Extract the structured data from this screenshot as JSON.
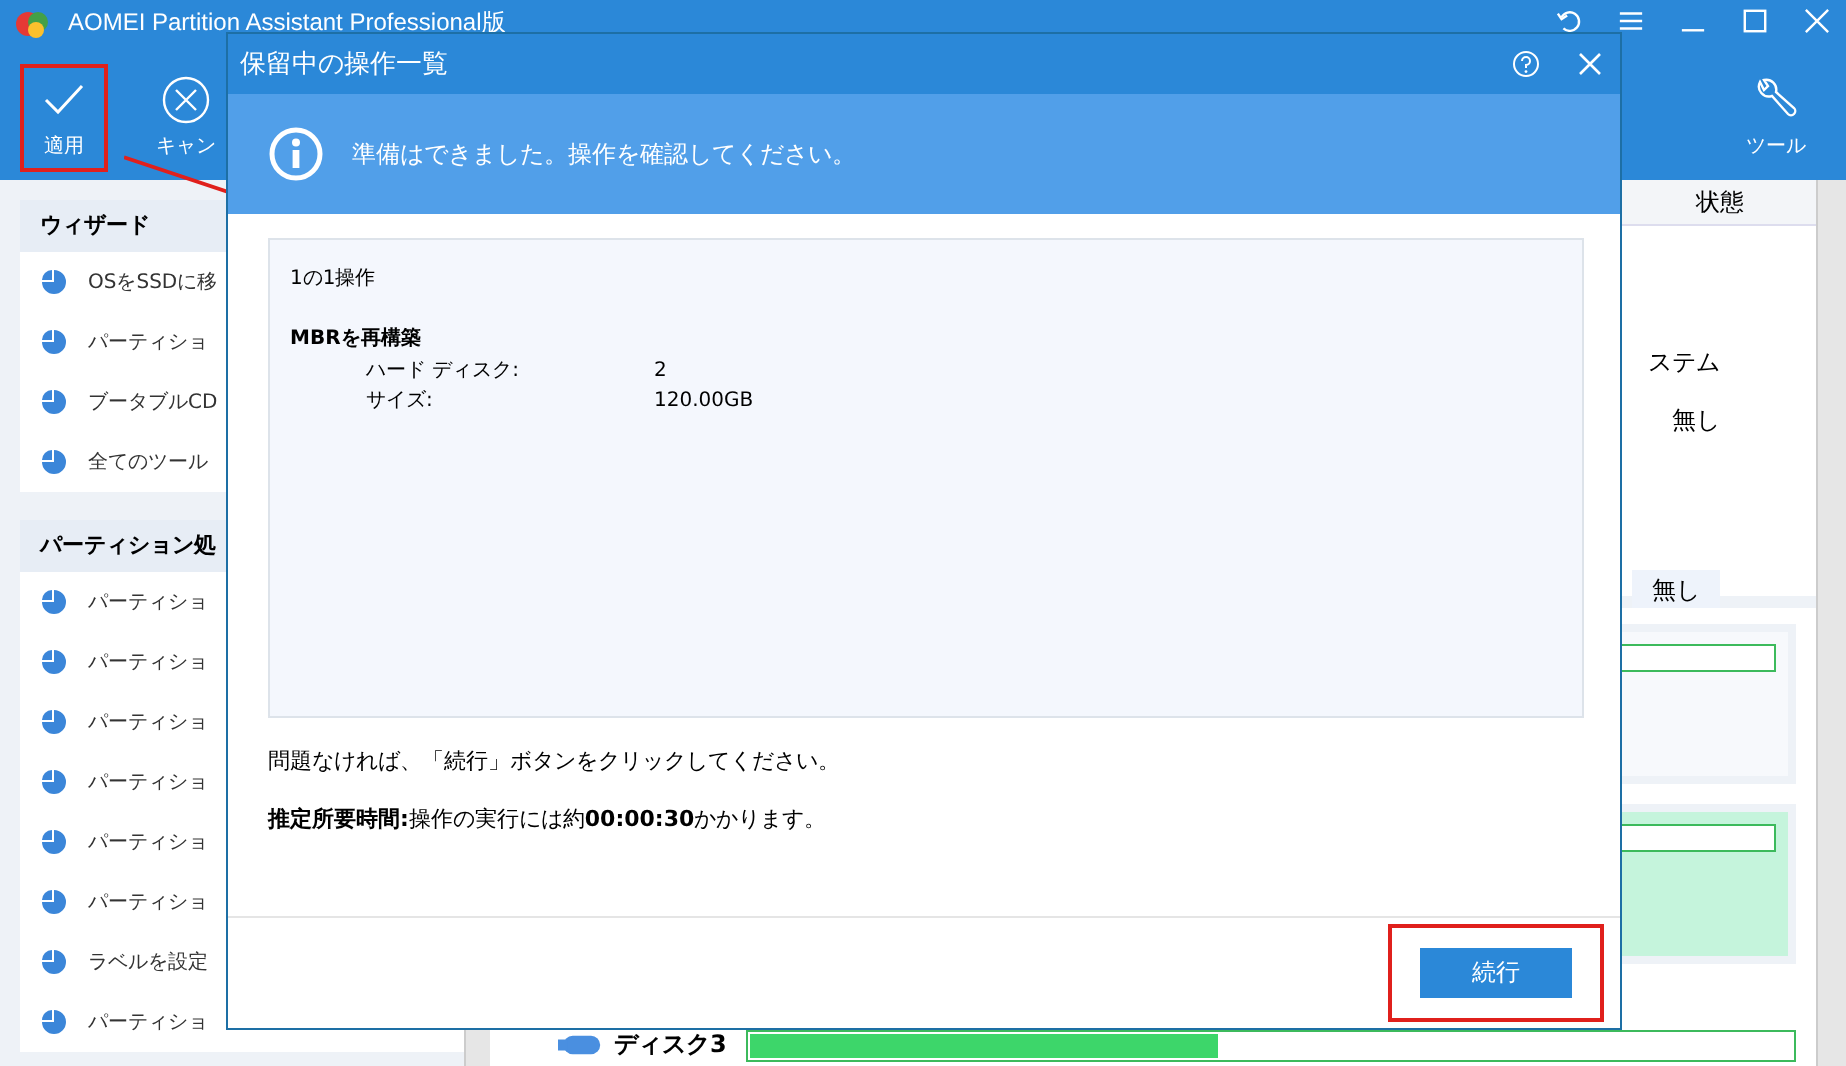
{
  "window": {
    "title": "AOMEI Partition Assistant Professional版"
  },
  "toolbar": [
    {
      "kind": "check",
      "label": "適用",
      "highlighted": true
    },
    {
      "kind": "cancel",
      "label": "キャン",
      "highlighted": false
    }
  ],
  "tools_button": {
    "label": "ツール"
  },
  "sidebar": {
    "sections": [
      {
        "title": "ウィザード",
        "items": [
          "OSをSSDに移",
          "パーティショ",
          "ブータブルCD",
          "全てのツール"
        ]
      },
      {
        "title": "パーティション処",
        "items": [
          "パーティショ",
          "パーティショ",
          "パーティショ",
          "パーティショ",
          "パーティショ",
          "パーティショ",
          "ラベルを設定",
          "パーティショ"
        ]
      }
    ]
  },
  "partition_table": {
    "column_header": "状態",
    "cells": [
      "ステム",
      "無し",
      "無し"
    ]
  },
  "disk_map": {
    "disk_label": "ディスク3",
    "level": 0.45
  },
  "dialog": {
    "title": "保留中の操作一覧",
    "banner": "準備はできました。操作を確認してください。",
    "count": "1の1操作",
    "operation": {
      "title": "MBRを再構築",
      "details": [
        {
          "label": "ハード ディスク:",
          "value": "2"
        },
        {
          "label": "サイズ:",
          "value": "120.00GB"
        }
      ]
    },
    "note": "問題なければ、「続行」ボタンをクリックしてください。",
    "estimate": "**推定所要時間:**操作の実行には約**00:00:30**かかります。",
    "continue_button": {
      "label": "続行",
      "highlighted": true
    }
  }
}
